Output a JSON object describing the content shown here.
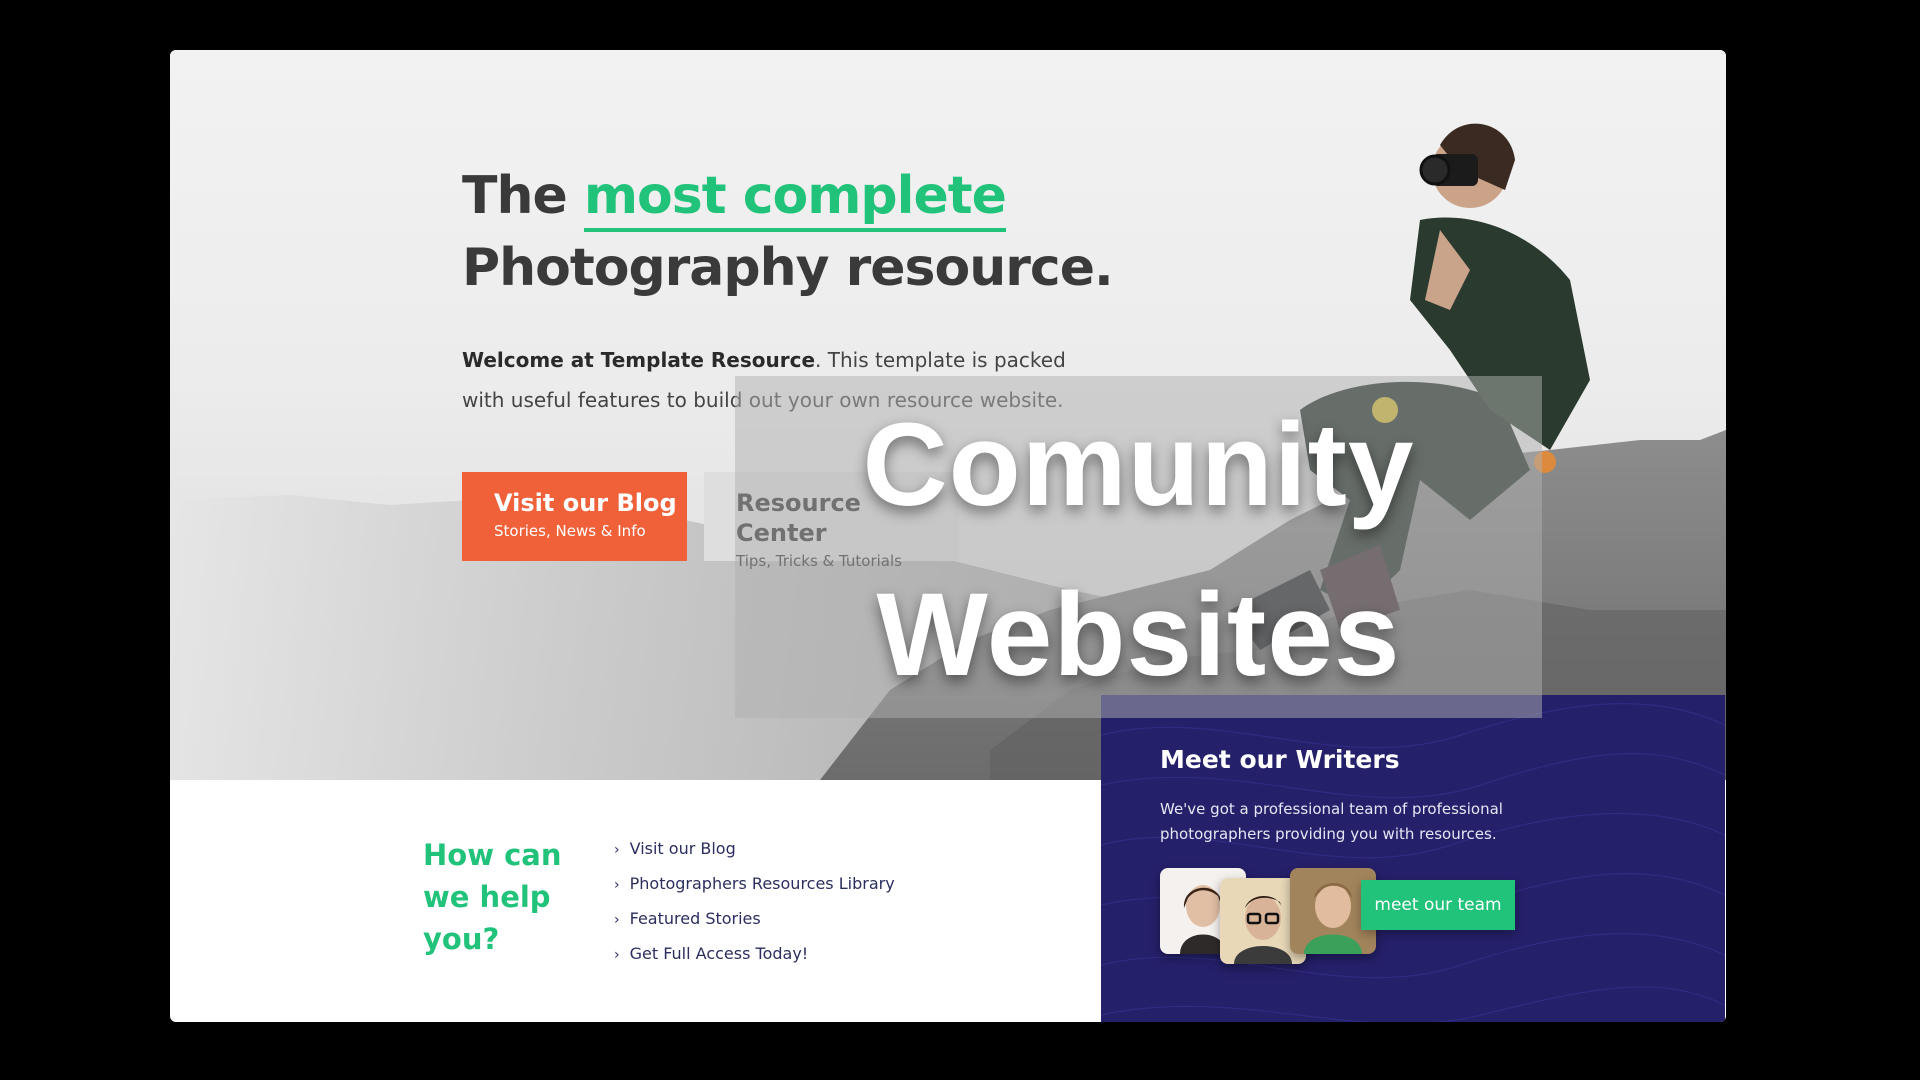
{
  "hero": {
    "title_prefix": "The ",
    "title_accent": "most complete",
    "title_line2": "Photography resource.",
    "intro_strong": "Welcome at Template Resource",
    "intro_rest": ". This template is packed with useful features to build out your own resource website.",
    "blog_button": {
      "label": "Visit our Blog",
      "sub": "Stories, News & Info"
    },
    "resource_button": {
      "label": "Resource Center",
      "sub": "Tips, Tricks & Tutorials"
    }
  },
  "help": {
    "title": "How can we help you?",
    "links": [
      "Visit our Blog",
      "Photographers Resources Library",
      "Featured Stories",
      "Get Full Access Today!"
    ]
  },
  "writers": {
    "title": "Meet our Writers",
    "text": "We've got a professional team of professional photographers providing you with resources.",
    "button": "meet our team"
  },
  "overlay": {
    "line1": "Comunity",
    "line2": "Websites"
  },
  "colors": {
    "accent_green": "#21c27a",
    "blog_orange": "#f0613a",
    "writers_navy": "#25206a",
    "link_navy": "#2b2e5e"
  },
  "icons": [
    "chevron-right-icon"
  ]
}
